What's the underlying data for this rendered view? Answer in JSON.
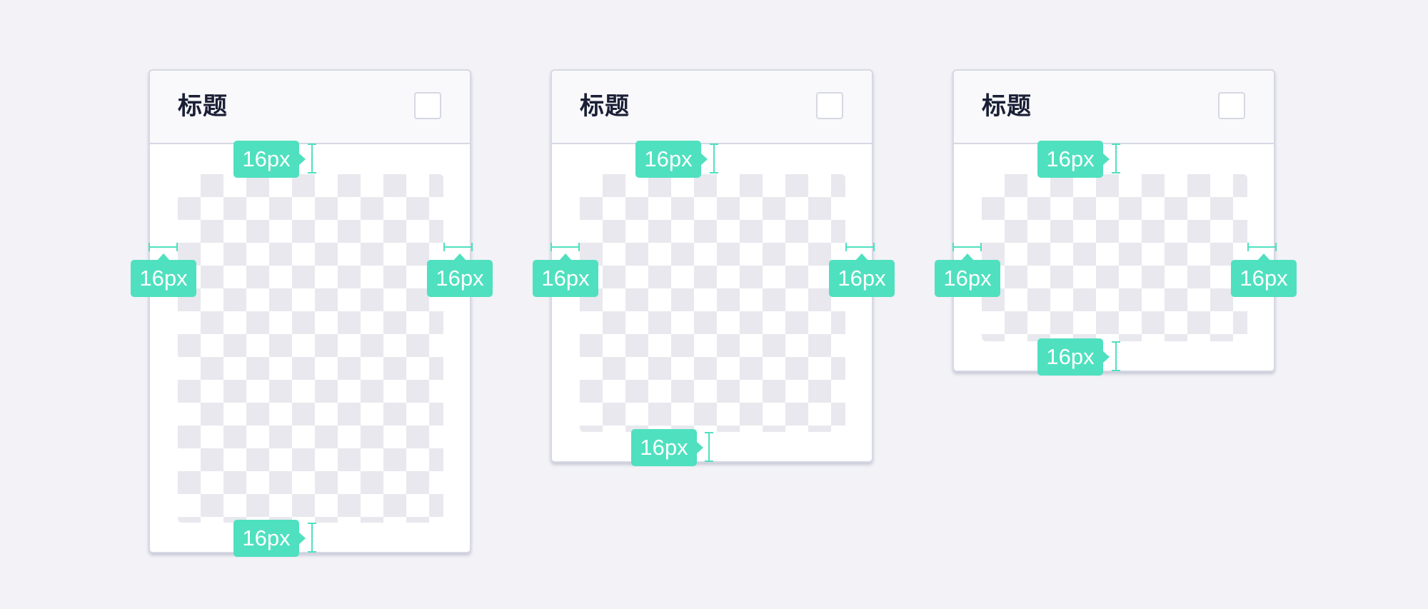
{
  "cards": [
    {
      "title": "标题",
      "padding_top_label": "16px",
      "padding_left_label": "16px",
      "padding_right_label": "16px",
      "padding_bottom_label": "16px"
    },
    {
      "title": "标题",
      "padding_top_label": "16px",
      "padding_left_label": "16px",
      "padding_right_label": "16px",
      "padding_bottom_label": "16px"
    },
    {
      "title": "标题",
      "padding_top_label": "16px",
      "padding_left_label": "16px",
      "padding_right_label": "16px",
      "padding_bottom_label": "16px"
    }
  ],
  "colors": {
    "background": "#f2f2f7",
    "accent": "#4fe0bf",
    "card_border": "#d6d8e4",
    "title_text": "#1a1f36"
  }
}
